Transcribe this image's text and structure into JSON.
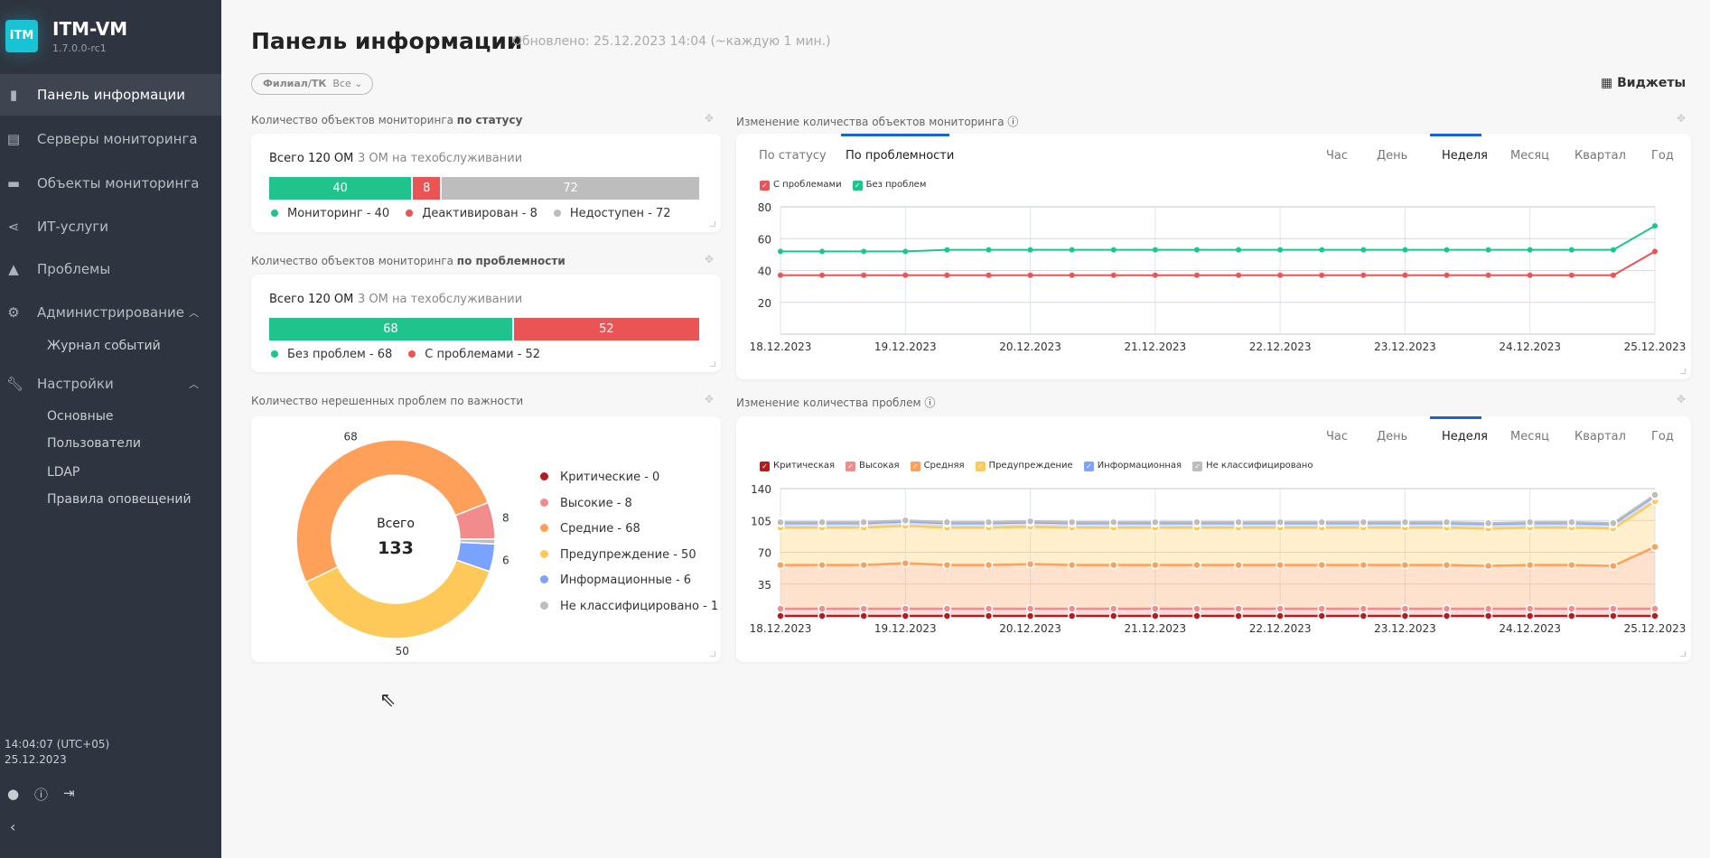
{
  "app": {
    "logo": "ITM",
    "name": "ITM-VM",
    "version": "1.7.0.0-rc1"
  },
  "sidebar": {
    "items": [
      {
        "label": "Панель информации",
        "icon": "bar-chart-icon"
      },
      {
        "label": "Серверы мониторинга",
        "icon": "server-icon"
      },
      {
        "label": "Объекты мониторинга",
        "icon": "monitor-icon"
      },
      {
        "label": "ИТ-услуги",
        "icon": "share-icon"
      },
      {
        "label": "Проблемы",
        "icon": "warning-icon"
      },
      {
        "label": "Администрирование",
        "icon": "gear-icon"
      },
      {
        "label": "Настройки",
        "icon": "wrench-icon"
      }
    ],
    "admin_sub": [
      "Журнал событий"
    ],
    "settings_sub": [
      "Основные",
      "Пользователи",
      "LDAP",
      "Правила оповещений"
    ],
    "time": "14:04:07 (UTC+05)",
    "date": "25.12.2023"
  },
  "header": {
    "title": "Панель информации",
    "updated": "Обновлено: 25.12.2023 14:04 (~каждую 1 мин.)",
    "filter_label": "Филиал/ТК",
    "filter_value": "Все",
    "widgets": "Виджеты"
  },
  "w_status": {
    "title": "Количество объектов мониторинга ",
    "title_bold": "по статусу",
    "total": "Всего 120 ОМ",
    "maint": "3 ОМ на техобслуживании",
    "segments": [
      {
        "label": "Мониторинг",
        "value": 40,
        "color": "#21c38d"
      },
      {
        "label": "Деактивирован",
        "value": 8,
        "color": "#ea5455"
      },
      {
        "label": "Недоступен",
        "value": 72,
        "color": "#bdbdbd"
      }
    ]
  },
  "w_problem": {
    "title": "Количество объектов мониторинга ",
    "title_bold": "по проблемности",
    "total": "Всего 120 ОМ",
    "maint": "3 ОМ на техобслуживании",
    "segments": [
      {
        "label": "Без проблем",
        "value": 68,
        "color": "#21c38d"
      },
      {
        "label": "С проблемами",
        "value": 52,
        "color": "#ea5455"
      }
    ]
  },
  "w_donut": {
    "title": "Количество нерешенных проблем по важности",
    "center_label": "Всего",
    "center_value": "133"
  },
  "w_line": {
    "title": "Изменение количества объектов мониторинга",
    "tabs": [
      "По статусу",
      "По проблемности"
    ],
    "active_tab": 1,
    "periods": [
      "Час",
      "День",
      "Неделя",
      "Месяц",
      "Квартал",
      "Год"
    ],
    "active_period": 2
  },
  "w_area": {
    "title": "Изменение количества проблем",
    "periods": [
      "Час",
      "День",
      "Неделя",
      "Месяц",
      "Квартал",
      "Год"
    ],
    "active_period": 2
  },
  "chart_data": [
    {
      "type": "pie",
      "slices": [
        {
          "label": "Критические",
          "value": 0,
          "color": "#b71c1c"
        },
        {
          "label": "Высокие",
          "value": 8,
          "color": "#f28b8b"
        },
        {
          "label": "Средние",
          "value": 68,
          "color": "#ffa05a"
        },
        {
          "label": "Предупреждение",
          "value": 50,
          "color": "#ffc95a"
        },
        {
          "label": "Информационные",
          "value": 6,
          "color": "#7aa2ff"
        },
        {
          "label": "Не классифицировано",
          "value": 1,
          "color": "#bdbdbd"
        }
      ]
    },
    {
      "type": "line",
      "ylim": [
        0,
        80
      ],
      "yticks": [
        20,
        40,
        60,
        80
      ],
      "grid": true,
      "legend": "top-left",
      "xticks": [
        "18.12.2023",
        "19.12.2023",
        "20.12.2023",
        "21.12.2023",
        "22.12.2023",
        "23.12.2023",
        "24.12.2023",
        "25.12.2023"
      ],
      "series": [
        {
          "name": "С проблемами",
          "color": "#ea5455",
          "values": [
            37,
            37,
            37,
            37,
            37,
            37,
            37,
            37,
            37,
            37,
            37,
            37,
            37,
            37,
            37,
            37,
            37,
            37,
            37,
            37,
            37,
            52
          ]
        },
        {
          "name": "Без проблем",
          "color": "#21c38d",
          "values": [
            52,
            52,
            52,
            52,
            53,
            53,
            53,
            53,
            53,
            53,
            53,
            53,
            53,
            53,
            53,
            53,
            53,
            53,
            53,
            53,
            53,
            68
          ]
        }
      ]
    },
    {
      "type": "area",
      "stacked": true,
      "ylim": [
        0,
        140
      ],
      "yticks": [
        35,
        70,
        105,
        140
      ],
      "grid": true,
      "legend": "top-left",
      "xticks": [
        "18.12.2023",
        "19.12.2023",
        "20.12.2023",
        "21.12.2023",
        "22.12.2023",
        "23.12.2023",
        "24.12.2023",
        "25.12.2023"
      ],
      "series": [
        {
          "name": "Критическая",
          "color": "#b71c1c",
          "values": [
            0,
            0,
            0,
            0,
            0,
            0,
            0,
            0,
            0,
            0,
            0,
            0,
            0,
            0,
            0,
            0,
            0,
            0,
            0,
            0,
            0,
            0
          ]
        },
        {
          "name": "Высокая",
          "color": "#f28b8b",
          "values": [
            8,
            8,
            8,
            8,
            8,
            8,
            8,
            8,
            8,
            8,
            8,
            8,
            8,
            8,
            8,
            8,
            8,
            8,
            8,
            8,
            8,
            8
          ]
        },
        {
          "name": "Средняя",
          "color": "#ffa05a",
          "values": [
            48,
            48,
            48,
            50,
            48,
            48,
            49,
            48,
            48,
            48,
            48,
            48,
            48,
            48,
            48,
            48,
            48,
            47,
            48,
            48,
            47,
            68
          ]
        },
        {
          "name": "Предупреждение",
          "color": "#ffc95a",
          "values": [
            41,
            41,
            41,
            41,
            41,
            41,
            41,
            41,
            41,
            41,
            41,
            41,
            41,
            41,
            41,
            41,
            41,
            41,
            41,
            41,
            41,
            50
          ]
        },
        {
          "name": "Информационная",
          "color": "#7aa2ff",
          "values": [
            5,
            5,
            5,
            5,
            5,
            5,
            5,
            5,
            5,
            5,
            5,
            5,
            5,
            5,
            5,
            5,
            5,
            5,
            5,
            5,
            5,
            6
          ]
        },
        {
          "name": "Не классифицировано",
          "color": "#bdbdbd",
          "values": [
            1,
            1,
            1,
            1,
            1,
            1,
            1,
            1,
            1,
            1,
            1,
            1,
            1,
            1,
            1,
            1,
            1,
            1,
            1,
            1,
            1,
            1
          ]
        }
      ]
    }
  ]
}
